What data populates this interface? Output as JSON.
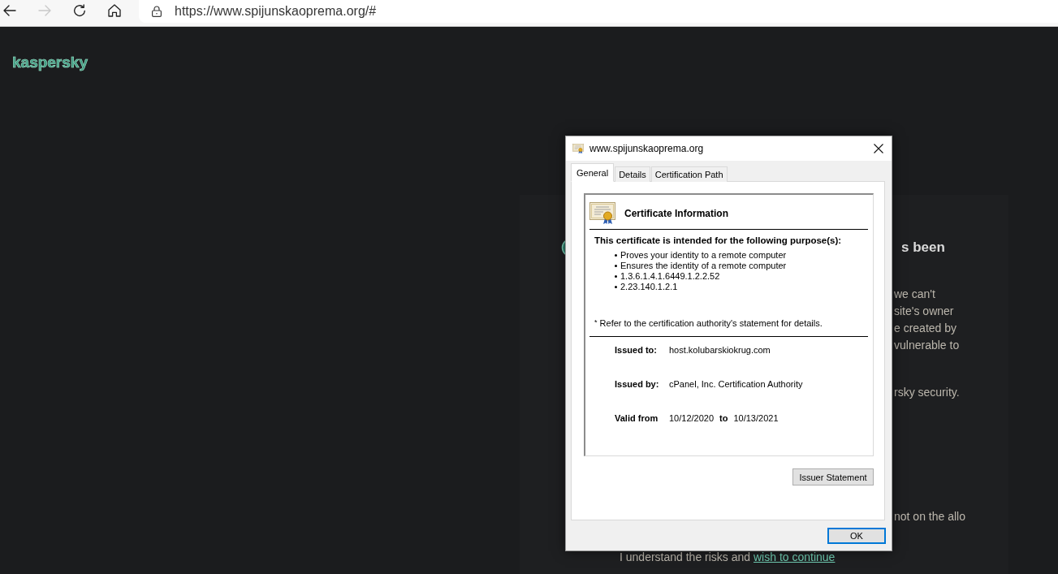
{
  "browser": {
    "nav_buttons": [
      {
        "kind": "back",
        "disabled": false
      },
      {
        "kind": "forward",
        "disabled": true
      },
      {
        "kind": "reload",
        "disabled": false
      },
      {
        "kind": "home",
        "disabled": false
      }
    ],
    "address": {
      "value": "https://www.spijunskaoprema.org/#"
    }
  },
  "page": {
    "logo": "kaspersky",
    "heading": "s been",
    "paragraphs": [
      {
        "lines": [
          "we can't",
          "site's owner",
          "e created by",
          "vulnerable to"
        ]
      },
      {
        "lines": [
          "rsky security."
        ]
      },
      {
        "lines": [
          "not on the allo"
        ]
      }
    ],
    "continue": {
      "text": "I understand the risks and",
      "link": "wish to continue"
    }
  },
  "dialog": {
    "title": "www.spijunskaoprema.org",
    "tabs": [
      {
        "label": "General",
        "selected": true
      },
      {
        "label": "Details",
        "selected": false
      },
      {
        "label": "Certification Path",
        "selected": false
      }
    ],
    "certificate": {
      "heading": "Certificate Information",
      "purpose_intro": "This certificate is intended for the following purpose(s):",
      "purposes": [
        "Proves your identity to a remote computer",
        "Ensures the identity of a remote computer",
        "1.3.6.1.4.1.6449.1.2.2.52",
        "2.23.140.1.2.1"
      ],
      "note": "$^{*}$ Refer to the certification authority's statement for details.",
      "fields": [
        {
          "label": "Issued to:",
          "value": "host.kolubarskiokrug.com"
        },
        {
          "label": "Issued by:",
          "value": "cPanel, Inc. Certification Authority"
        }
      ],
      "validity": {
        "label": "Valid from",
        "from": "10/12/2020",
        "to_label": "to",
        "to": "10/13/2021"
      }
    },
    "issuer_button": {
      "label": "Issuer Statement"
    },
    "ok_button": {
      "label": "OK",
      "default": true
    }
  }
}
